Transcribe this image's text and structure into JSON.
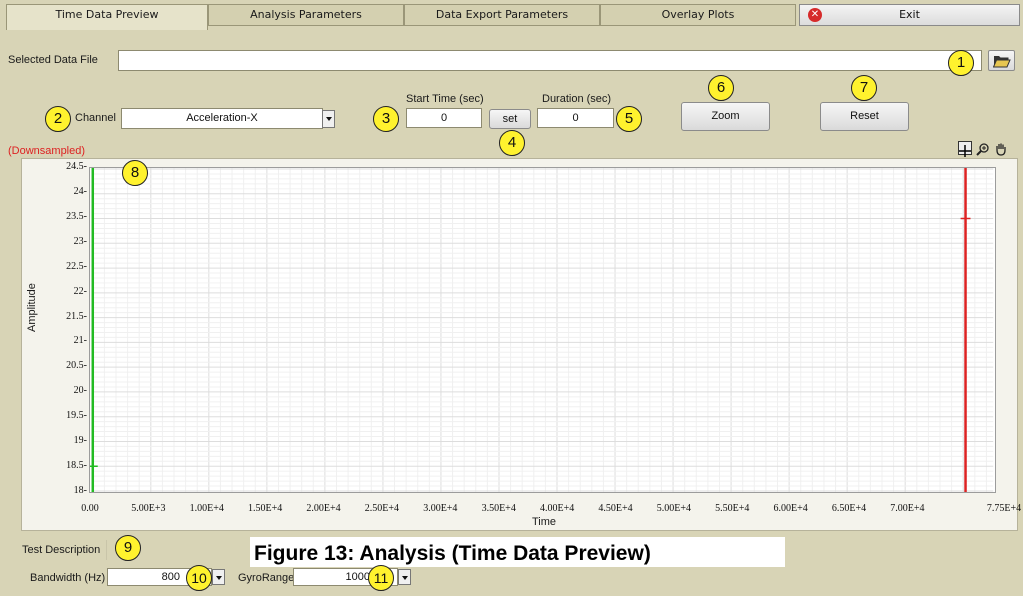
{
  "tabs": [
    {
      "label": "Time Data Preview",
      "active": true
    },
    {
      "label": "Analysis Parameters",
      "active": false
    },
    {
      "label": "Data Export Parameters",
      "active": false
    },
    {
      "label": "Overlay Plots",
      "active": false
    }
  ],
  "exit": {
    "label": "Exit",
    "icon": "close-circle-icon"
  },
  "file": {
    "label": "Selected Data File",
    "value": "",
    "browse_icon": "folder-open-icon"
  },
  "channel": {
    "label": "Channel",
    "value": "Acceleration-X"
  },
  "start_time": {
    "label": "Start Time (sec)",
    "value": "0"
  },
  "set_button": "set",
  "duration": {
    "label": "Duration (sec)",
    "value": "0"
  },
  "zoom_button": "Zoom",
  "reset_button": "Reset",
  "downsampled_label": "(Downsampled)",
  "plot_tools": [
    "crosshair-icon",
    "zoom-icon",
    "pan-hand-icon"
  ],
  "chart_data": {
    "type": "line",
    "xlabel": "Time",
    "ylabel": "Amplitude",
    "ylim": [
      18,
      24.5
    ],
    "xlim": [
      0,
      77500
    ],
    "y_ticks": [
      "18",
      "18.5",
      "19",
      "19.5",
      "20",
      "20.5",
      "21",
      "21.5",
      "22",
      "22.5",
      "23",
      "23.5",
      "24",
      "24.5"
    ],
    "x_ticks": [
      "0.00",
      "5.00E+3",
      "1.00E+4",
      "1.50E+4",
      "2.00E+4",
      "2.50E+4",
      "3.00E+4",
      "3.50E+4",
      "4.00E+4",
      "4.50E+4",
      "5.00E+4",
      "5.50E+4",
      "6.00E+4",
      "6.50E+4",
      "7.00E+4",
      "7.75E+4"
    ],
    "cursors": [
      {
        "x": 0,
        "marker_y": 18.5,
        "color": "#22bb22"
      },
      {
        "x": 75200,
        "marker_y": 23.5,
        "color": "#dd2222"
      }
    ],
    "grid": true
  },
  "test_description_label": "Test Description",
  "bandwidth": {
    "label": "Bandwidth (Hz)",
    "value": "800"
  },
  "gyro_range": {
    "label": "GyroRange",
    "value": "1000"
  },
  "callouts": [
    "1",
    "2",
    "3",
    "4",
    "5",
    "6",
    "7",
    "8",
    "9",
    "10",
    "11"
  ],
  "caption": "Figure 13: Analysis (Time Data Preview)",
  "colors": {
    "panel": "#d8d4b6",
    "callout": "#fff22e",
    "downsampled": "#dd2222"
  }
}
